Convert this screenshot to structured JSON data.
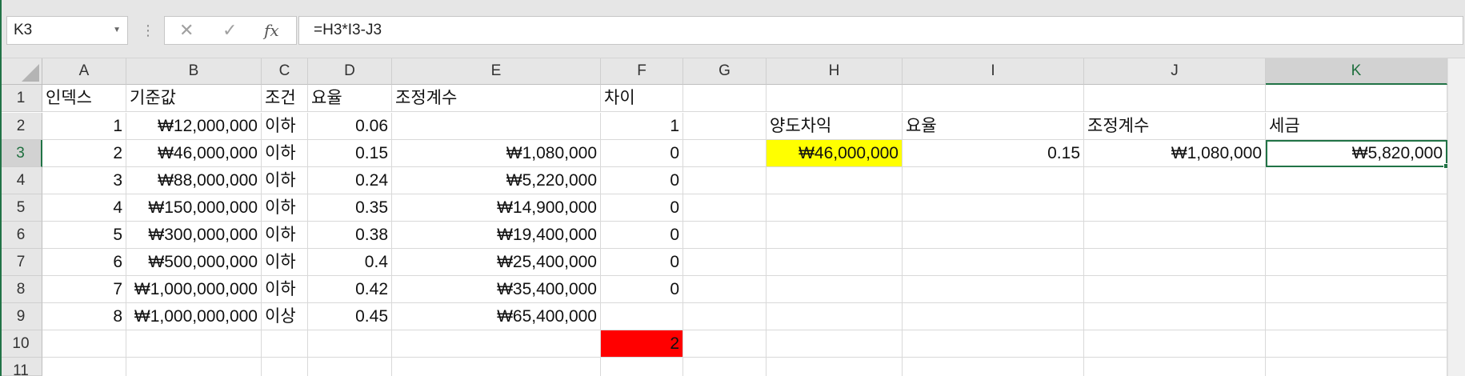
{
  "formula_bar": {
    "name_box": "K3",
    "cancel_icon": "✕",
    "enter_icon": "✓",
    "fx_label": "fx",
    "formula": "=H3*I3-J3"
  },
  "columns": [
    "A",
    "B",
    "C",
    "D",
    "E",
    "F",
    "G",
    "H",
    "I",
    "J",
    "K"
  ],
  "rows": [
    "1",
    "2",
    "3",
    "4",
    "5",
    "6",
    "7",
    "8",
    "9",
    "10",
    "11"
  ],
  "selected_cell": {
    "col": "K",
    "row": "3"
  },
  "cells": [
    {
      "r": 1,
      "c": "A",
      "v": "인덱스",
      "t": "txt"
    },
    {
      "r": 1,
      "c": "B",
      "v": "기준값",
      "t": "txt"
    },
    {
      "r": 1,
      "c": "C",
      "v": "조건",
      "t": "txt"
    },
    {
      "r": 1,
      "c": "D",
      "v": "요율",
      "t": "txt"
    },
    {
      "r": 1,
      "c": "E",
      "v": "조정계수",
      "t": "txt"
    },
    {
      "r": 1,
      "c": "F",
      "v": "차이",
      "t": "txt"
    },
    {
      "r": 2,
      "c": "A",
      "v": "1",
      "t": "num"
    },
    {
      "r": 2,
      "c": "B",
      "v": "₩12,000,000",
      "t": "num"
    },
    {
      "r": 2,
      "c": "C",
      "v": "이하",
      "t": "txt"
    },
    {
      "r": 2,
      "c": "D",
      "v": "0.06",
      "t": "num"
    },
    {
      "r": 2,
      "c": "F",
      "v": "1",
      "t": "num"
    },
    {
      "r": 2,
      "c": "H",
      "v": "양도차익",
      "t": "txt"
    },
    {
      "r": 2,
      "c": "I",
      "v": "요율",
      "t": "txt"
    },
    {
      "r": 2,
      "c": "J",
      "v": "조정계수",
      "t": "txt"
    },
    {
      "r": 2,
      "c": "K",
      "v": "세금",
      "t": "txt"
    },
    {
      "r": 3,
      "c": "A",
      "v": "2",
      "t": "num"
    },
    {
      "r": 3,
      "c": "B",
      "v": "₩46,000,000",
      "t": "num"
    },
    {
      "r": 3,
      "c": "C",
      "v": "이하",
      "t": "txt"
    },
    {
      "r": 3,
      "c": "D",
      "v": "0.15",
      "t": "num"
    },
    {
      "r": 3,
      "c": "E",
      "v": "₩1,080,000",
      "t": "num"
    },
    {
      "r": 3,
      "c": "F",
      "v": "0",
      "t": "num"
    },
    {
      "r": 3,
      "c": "H",
      "v": "₩46,000,000",
      "t": "num",
      "fill": "#ffff00"
    },
    {
      "r": 3,
      "c": "I",
      "v": "0.15",
      "t": "num"
    },
    {
      "r": 3,
      "c": "J",
      "v": "₩1,080,000",
      "t": "num"
    },
    {
      "r": 3,
      "c": "K",
      "v": "₩5,820,000",
      "t": "num"
    },
    {
      "r": 4,
      "c": "A",
      "v": "3",
      "t": "num"
    },
    {
      "r": 4,
      "c": "B",
      "v": "₩88,000,000",
      "t": "num"
    },
    {
      "r": 4,
      "c": "C",
      "v": "이하",
      "t": "txt"
    },
    {
      "r": 4,
      "c": "D",
      "v": "0.24",
      "t": "num"
    },
    {
      "r": 4,
      "c": "E",
      "v": "₩5,220,000",
      "t": "num"
    },
    {
      "r": 4,
      "c": "F",
      "v": "0",
      "t": "num"
    },
    {
      "r": 5,
      "c": "A",
      "v": "4",
      "t": "num"
    },
    {
      "r": 5,
      "c": "B",
      "v": "₩150,000,000",
      "t": "num"
    },
    {
      "r": 5,
      "c": "C",
      "v": "이하",
      "t": "txt"
    },
    {
      "r": 5,
      "c": "D",
      "v": "0.35",
      "t": "num"
    },
    {
      "r": 5,
      "c": "E",
      "v": "₩14,900,000",
      "t": "num"
    },
    {
      "r": 5,
      "c": "F",
      "v": "0",
      "t": "num"
    },
    {
      "r": 6,
      "c": "A",
      "v": "5",
      "t": "num"
    },
    {
      "r": 6,
      "c": "B",
      "v": "₩300,000,000",
      "t": "num"
    },
    {
      "r": 6,
      "c": "C",
      "v": "이하",
      "t": "txt"
    },
    {
      "r": 6,
      "c": "D",
      "v": "0.38",
      "t": "num"
    },
    {
      "r": 6,
      "c": "E",
      "v": "₩19,400,000",
      "t": "num"
    },
    {
      "r": 6,
      "c": "F",
      "v": "0",
      "t": "num"
    },
    {
      "r": 7,
      "c": "A",
      "v": "6",
      "t": "num"
    },
    {
      "r": 7,
      "c": "B",
      "v": "₩500,000,000",
      "t": "num"
    },
    {
      "r": 7,
      "c": "C",
      "v": "이하",
      "t": "txt"
    },
    {
      "r": 7,
      "c": "D",
      "v": "0.4",
      "t": "num"
    },
    {
      "r": 7,
      "c": "E",
      "v": "₩25,400,000",
      "t": "num"
    },
    {
      "r": 7,
      "c": "F",
      "v": "0",
      "t": "num"
    },
    {
      "r": 8,
      "c": "A",
      "v": "7",
      "t": "num"
    },
    {
      "r": 8,
      "c": "B",
      "v": "₩1,000,000,000",
      "t": "num"
    },
    {
      "r": 8,
      "c": "C",
      "v": "이하",
      "t": "txt"
    },
    {
      "r": 8,
      "c": "D",
      "v": "0.42",
      "t": "num"
    },
    {
      "r": 8,
      "c": "E",
      "v": "₩35,400,000",
      "t": "num"
    },
    {
      "r": 8,
      "c": "F",
      "v": "0",
      "t": "num"
    },
    {
      "r": 9,
      "c": "A",
      "v": "8",
      "t": "num"
    },
    {
      "r": 9,
      "c": "B",
      "v": "₩1,000,000,000",
      "t": "num"
    },
    {
      "r": 9,
      "c": "C",
      "v": "이상",
      "t": "txt"
    },
    {
      "r": 9,
      "c": "D",
      "v": "0.45",
      "t": "num"
    },
    {
      "r": 9,
      "c": "E",
      "v": "₩65,400,000",
      "t": "num"
    },
    {
      "r": 10,
      "c": "F",
      "v": "2",
      "t": "num",
      "fill": "#ff0000"
    }
  ]
}
